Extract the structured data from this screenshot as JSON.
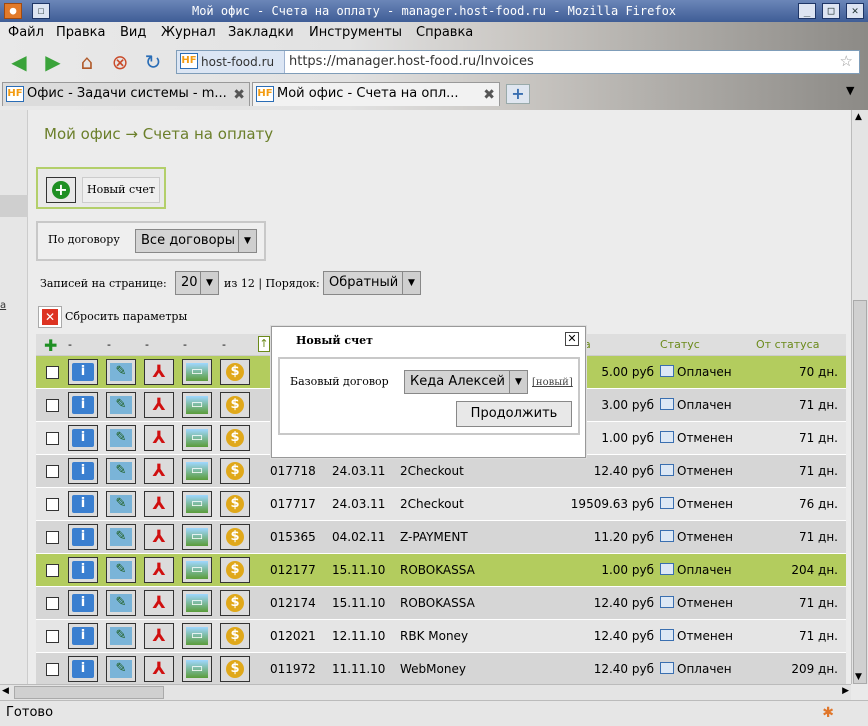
{
  "window": {
    "title": "Мой офис - Счета на оплату - manager.host-food.ru - Mozilla Firefox"
  },
  "menu": [
    "Файл",
    "Правка",
    "Вид",
    "Журнал",
    "Закладки",
    "Инструменты",
    "Справка"
  ],
  "toolbar": {
    "site_badge": "host-food.ru",
    "url": "https://manager.host-food.ru/Invoices"
  },
  "tabs": [
    {
      "label": "Офис - Задачи системы - m..."
    },
    {
      "label": "Мой офис - Счета на опл..."
    }
  ],
  "page": {
    "breadcrumb": "Мой офис → Счета на оплату",
    "new_invoice_label": "Новый счет",
    "filter_label": "По договору",
    "filter_value": "Все договоры",
    "per_page_label": "Записей на странице:",
    "per_page_value": "20",
    "total_text": "из 12 | Порядок:",
    "order_value": "Обратный",
    "reset_label": "Сбросить параметры"
  },
  "table": {
    "dashes": [
      "-",
      "-",
      "-",
      "-",
      "-"
    ],
    "col_sum_fragment": "а",
    "col_status": "Статус",
    "col_since": "От статуса",
    "rows": [
      {
        "num": "",
        "date": "",
        "system": "",
        "sum": "5.00 руб",
        "status": "Оплачен",
        "since": "70 дн.",
        "hl": true
      },
      {
        "num": "",
        "date": "",
        "system": "",
        "sum": "3.00 руб",
        "status": "Оплачен",
        "since": "71 дн.",
        "hl": false
      },
      {
        "num": "",
        "date": "",
        "system": "",
        "sum": "1.00 руб",
        "status": "Отменен",
        "since": "71 дн.",
        "hl": false
      },
      {
        "num": "017718",
        "date": "24.03.11",
        "system": "2Checkout",
        "sum": "12.40 руб",
        "status": "Отменен",
        "since": "71 дн.",
        "hl": false
      },
      {
        "num": "017717",
        "date": "24.03.11",
        "system": "2Checkout",
        "sum": "19509.63 руб",
        "status": "Отменен",
        "since": "76 дн.",
        "hl": false
      },
      {
        "num": "015365",
        "date": "04.02.11",
        "system": "Z-PAYMENT",
        "sum": "11.20 руб",
        "status": "Отменен",
        "since": "71 дн.",
        "hl": false
      },
      {
        "num": "012177",
        "date": "15.11.10",
        "system": "ROBOKASSA",
        "sum": "1.00 руб",
        "status": "Оплачен",
        "since": "204 дн.",
        "hl": true
      },
      {
        "num": "012174",
        "date": "15.11.10",
        "system": "ROBOKASSA",
        "sum": "12.40 руб",
        "status": "Отменен",
        "since": "71 дн.",
        "hl": false
      },
      {
        "num": "012021",
        "date": "12.11.10",
        "system": "RBK Money",
        "sum": "12.40 руб",
        "status": "Отменен",
        "since": "71 дн.",
        "hl": false
      },
      {
        "num": "011972",
        "date": "11.11.10",
        "system": "WebMoney",
        "sum": "12.40 руб",
        "status": "Оплачен",
        "since": "209 дн.",
        "hl": false
      }
    ]
  },
  "modal": {
    "title": "Новый счет",
    "base_contract_label": "Базовый договор",
    "contract_value": "Кеда Алексей",
    "new_link": "[новый]",
    "continue_label": "Продолжить"
  },
  "statusbar": {
    "text": "Готово"
  }
}
